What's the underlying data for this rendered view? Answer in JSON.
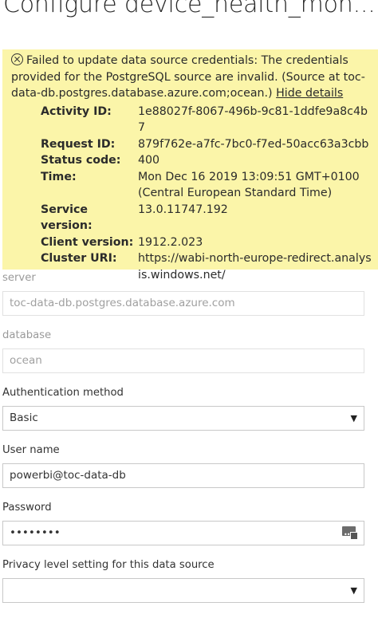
{
  "page": {
    "title": "Configure device_health_mon..."
  },
  "error": {
    "message": "Failed to update data source credentials: The credentials provided for the PostgreSQL source are invalid. (Source at toc-data-db.postgres.database.azure.com;ocean.)",
    "hide_details_label": "Hide details",
    "details": [
      {
        "label": "Activity ID:",
        "value": "1e88027f-8067-496b-9c81-1ddfe9a8c4b7"
      },
      {
        "label": "Request ID:",
        "value": "879f762e-a7fc-7bc0-f7ed-50acc63a3cbb"
      },
      {
        "label": "Status code:",
        "value": "400"
      },
      {
        "label": "Time:",
        "value": "Mon Dec 16 2019 13:09:51 GMT+0100 (Central European Standard Time)"
      },
      {
        "label": "Service version:",
        "value": "13.0.11747.192"
      },
      {
        "label": "Client version:",
        "value": "1912.2.023"
      },
      {
        "label": "Cluster URI:",
        "value": "https://wabi-north-europe-redirect.analysis.windows.net/"
      }
    ]
  },
  "form": {
    "server": {
      "label": "server",
      "value": "toc-data-db.postgres.database.azure.com"
    },
    "database": {
      "label": "database",
      "value": "ocean"
    },
    "auth_method": {
      "label": "Authentication method",
      "value": "Basic"
    },
    "username": {
      "label": "User name",
      "value": "powerbi@toc-data-db"
    },
    "password": {
      "label": "Password",
      "value": "••••••••"
    },
    "privacy": {
      "label": "Privacy level setting for this data source",
      "value": ""
    }
  },
  "icons": {
    "error": "error-circle-x-icon",
    "dropdown": "chevron-down-icon",
    "password": "show-password-icon"
  }
}
